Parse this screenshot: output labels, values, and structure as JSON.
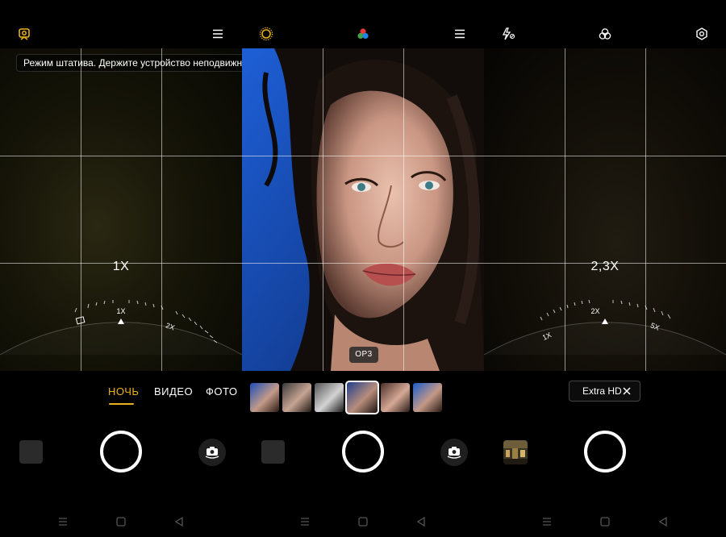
{
  "screen1": {
    "toast": "Режим штатива. Держите устройство неподвижно.",
    "zoom_value": "1X",
    "dial_labels": [
      "1X",
      "2X"
    ],
    "modes": [
      {
        "label": "НОЧЬ",
        "active": true
      },
      {
        "label": "ВИДЕО",
        "active": false
      },
      {
        "label": "ФОТО",
        "active": false
      }
    ],
    "top_icons": [
      "tripod-mode-icon",
      "menu-icon"
    ]
  },
  "screen2": {
    "filter_tag": "OP3",
    "top_icons": [
      "sun-filter-icon",
      "color-filter-icon",
      "menu-icon"
    ],
    "filter_thumbnails": 6,
    "selected_filter_index": 3
  },
  "screen3": {
    "zoom_value": "2,3X",
    "dial_labels": [
      "1X",
      "2X",
      "5X"
    ],
    "pill_label": "Extra HD",
    "top_icons": [
      "flash-off-icon",
      "filters-icon",
      "settings-icon"
    ]
  },
  "accent_color": "#e9b21c"
}
